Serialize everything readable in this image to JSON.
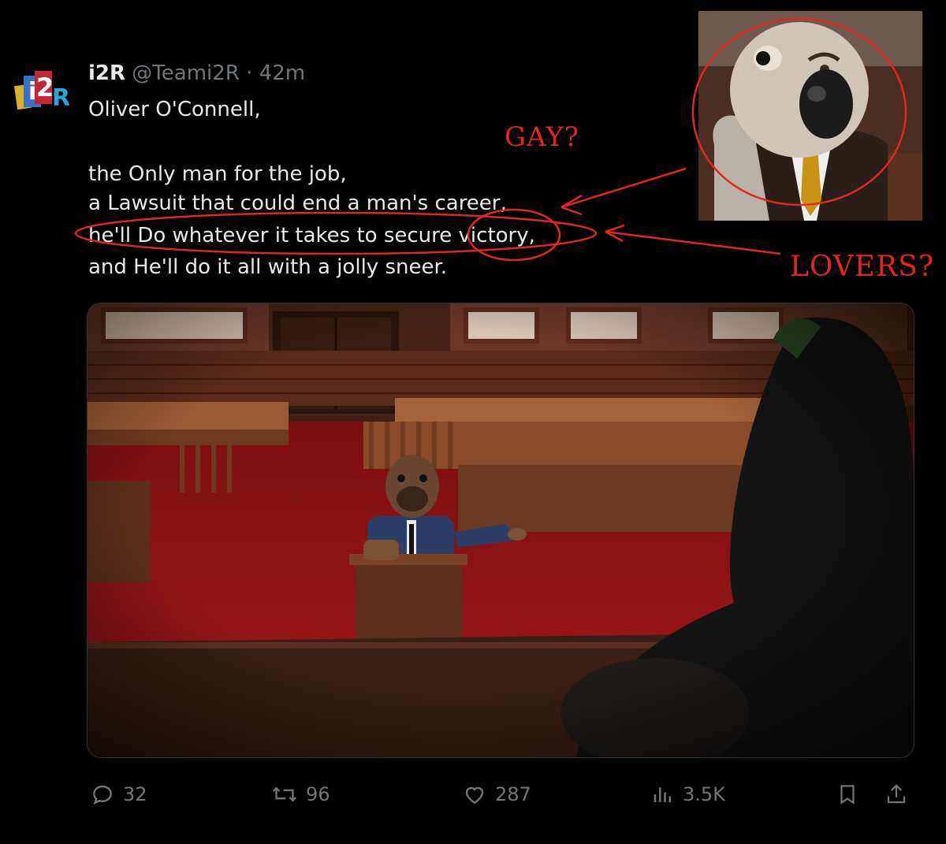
{
  "tweet": {
    "name": "i2R",
    "handle": "@Teami2R",
    "separator": "·",
    "time": "42m",
    "more_icon": "more-icon",
    "lines": [
      "Oliver O'Connell,",
      "the Only man for the job,",
      "a Lawsuit that could end a man's career,",
      "he'll Do whatever it takes to secure victory,",
      "and He'll do it all with a jolly sneer."
    ]
  },
  "actions": {
    "reply": {
      "icon": "reply-icon",
      "count": "32"
    },
    "repost": {
      "icon": "repost-icon",
      "count": "96"
    },
    "like": {
      "icon": "heart-icon",
      "count": "287"
    },
    "views": {
      "icon": "views-icon",
      "count": "3.5K"
    },
    "bookmark": {
      "icon": "bookmark-icon"
    },
    "share": {
      "icon": "share-icon"
    }
  },
  "annotations": {
    "gay": "GAY?",
    "lovers": "LOVERS?",
    "color": "#e0281e"
  },
  "colors": {
    "background": "#000000",
    "text": "#e7e9ea",
    "muted": "#71767b",
    "carpet": "#8c1212"
  }
}
